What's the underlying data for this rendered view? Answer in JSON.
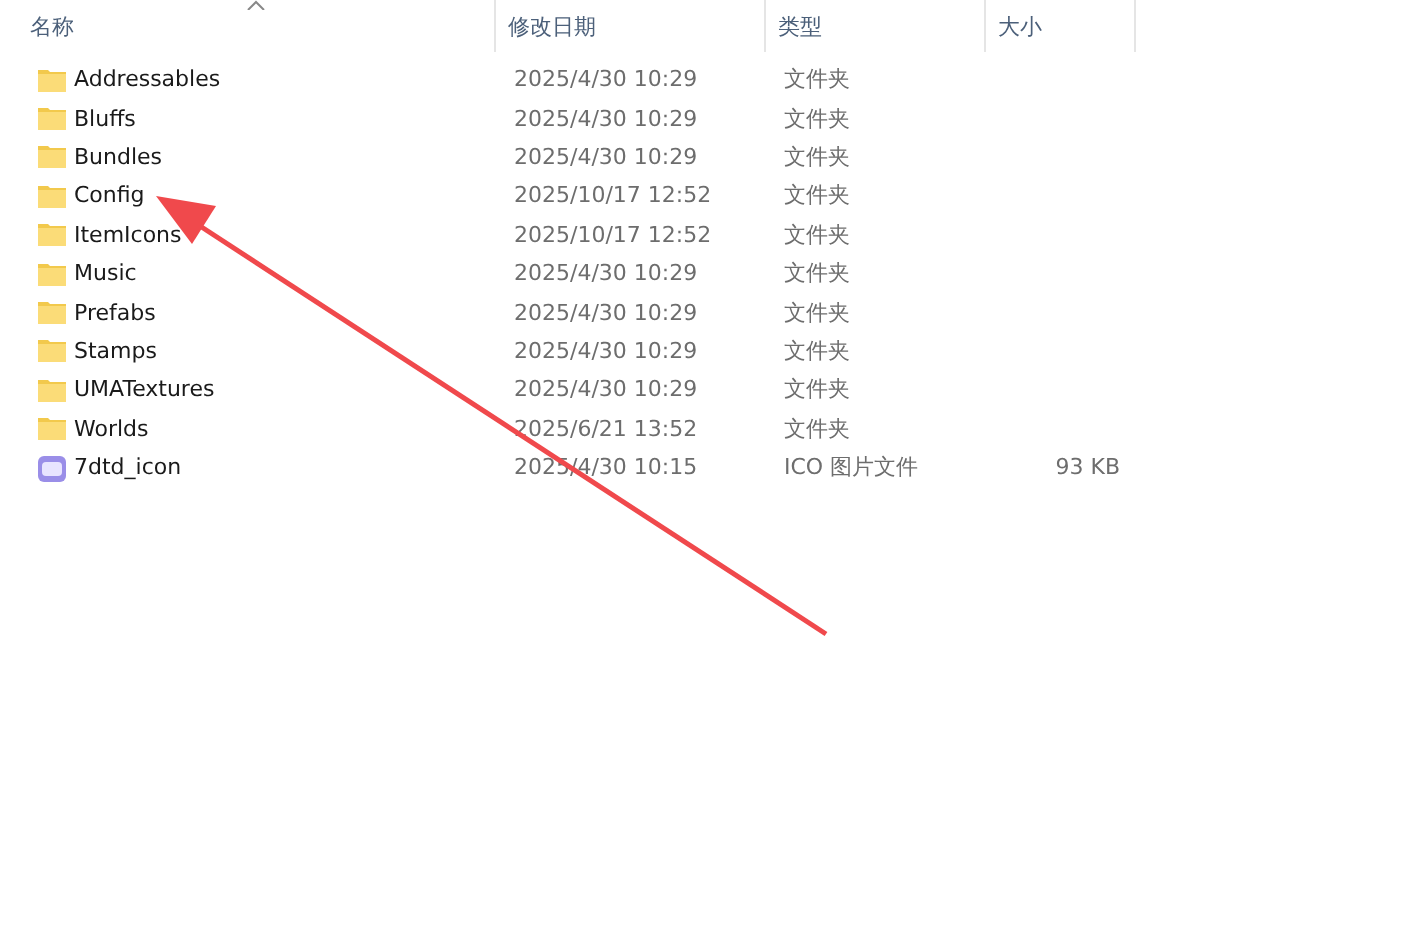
{
  "columns": [
    {
      "label": "名称",
      "sorted": true
    },
    {
      "label": "修改日期",
      "sorted": false
    },
    {
      "label": "类型",
      "sorted": false
    },
    {
      "label": "大小",
      "sorted": false
    }
  ],
  "rows": [
    {
      "kind": "folder",
      "name": "Addressables",
      "date": "2025/4/30 10:29",
      "type": "文件夹"
    },
    {
      "kind": "folder",
      "name": "Bluffs",
      "date": "2025/4/30 10:29",
      "type": "文件夹"
    },
    {
      "kind": "folder",
      "name": "Bundles",
      "date": "2025/4/30 10:29",
      "type": "文件夹"
    },
    {
      "kind": "folder",
      "name": "Config",
      "date": "2025/10/17 12:52",
      "type": "文件夹"
    },
    {
      "kind": "folder",
      "name": "ItemIcons",
      "date": "2025/10/17 12:52",
      "type": "文件夹"
    },
    {
      "kind": "folder",
      "name": "Music",
      "date": "2025/4/30 10:29",
      "type": "文件夹"
    },
    {
      "kind": "folder",
      "name": "Prefabs",
      "date": "2025/4/30 10:29",
      "type": "文件夹"
    },
    {
      "kind": "folder",
      "name": "Stamps",
      "date": "2025/4/30 10:29",
      "type": "文件夹"
    },
    {
      "kind": "folder",
      "name": "UMATextures",
      "date": "2025/4/30 10:29",
      "type": "文件夹"
    },
    {
      "kind": "folder",
      "name": "Worlds",
      "date": "2025/6/21 13:52",
      "type": "文件夹"
    },
    {
      "kind": "icon-file",
      "name": "7dtd_icon",
      "date": "2025/4/30 10:15",
      "type": "ICO 图片文件",
      "size": "93 KB"
    }
  ]
}
